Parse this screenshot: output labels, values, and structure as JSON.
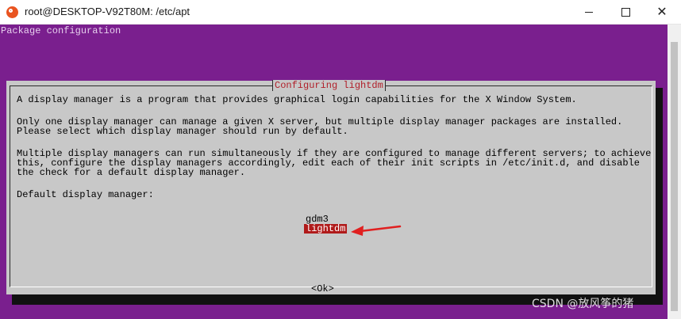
{
  "window": {
    "title": "root@DESKTOP-V92T80M: /etc/apt",
    "app_icon": "ubuntu-icon",
    "controls": [
      "minimize",
      "maximize",
      "close"
    ]
  },
  "terminal": {
    "header": "Package configuration",
    "background_color": "#7a1f8e"
  },
  "dialog": {
    "title": "Configuring lightdm",
    "paragraph1": "A display manager is a program that provides graphical login capabilities for the X Window System.",
    "paragraph2_line1": "Only one display manager can manage a given X server, but multiple display manager packages are installed.",
    "paragraph2_line2": "Please select which display manager should run by default.",
    "paragraph3_line1": "Multiple display managers can run simultaneously if they are configured to manage different servers; to achieve",
    "paragraph3_line2": "this, configure the display managers accordingly, edit each of their init scripts in /etc/init.d, and disable",
    "paragraph3_line3": "the check for a default display manager.",
    "prompt": "Default display manager:",
    "options": [
      "gdm3",
      "lightdm"
    ],
    "selected_option": "lightdm",
    "ok_label": "<Ok>"
  },
  "annotation": {
    "arrow_color": "#e02020",
    "points_to": "lightdm"
  },
  "watermark": "CSDN @放风筝的猪"
}
